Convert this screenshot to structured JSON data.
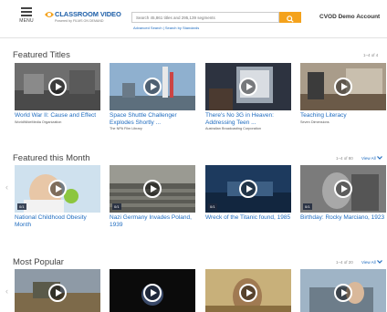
{
  "header": {
    "menu_label": "MENU",
    "logo_title": "CLASSROOM VIDEO",
    "logo_subtitle": "Powered by FILMS ON DEMAND",
    "search_placeholder": "Search 45,861 titles and 295,139 segments",
    "advanced_search": "Advanced Search",
    "search_sep": " | ",
    "search_by_standards": "Search by Standards",
    "account": "CVOD Demo Account",
    "accent_color": "#f4a21c",
    "brand_color": "#1e5fa8"
  },
  "sections": {
    "featured": {
      "title": "Featured Titles",
      "counter": "1–4 of 4",
      "cards": [
        {
          "title": "World War II: Cause and Effect",
          "publisher": "WorldWideMedia Organization"
        },
        {
          "title": "Space Shuttle Challenger Explodes Shortly ...",
          "publisher": "The NPA Film Library"
        },
        {
          "title": "There's No 3G in Heaven: Addressing Teen ...",
          "publisher": "Australian Broadcasting Corporation"
        },
        {
          "title": "Teaching Literacy",
          "publisher": "Seven Dimensions"
        }
      ]
    },
    "month": {
      "title": "Featured this Month",
      "counter": "1–4 of 80",
      "view_all": "View All",
      "cards": [
        {
          "title": "National Childhood Obesity Month",
          "badge": "0/1"
        },
        {
          "title": "Nazi Germany Invades Poland, 1939",
          "badge": "0/1"
        },
        {
          "title": "Wreck of the Titanic found, 1985",
          "badge": "0/1"
        },
        {
          "title": "Birthday: Rocky Marciano, 1923",
          "badge": "0/1"
        }
      ]
    },
    "popular": {
      "title": "Most Popular",
      "counter": "1–4 of 20",
      "view_all": "View All"
    }
  },
  "icons": {
    "menu": "hamburger-icon",
    "search": "search-icon",
    "play": "play-icon",
    "prev": "chevron-left-icon",
    "view_all": "chevron-down-icon"
  }
}
